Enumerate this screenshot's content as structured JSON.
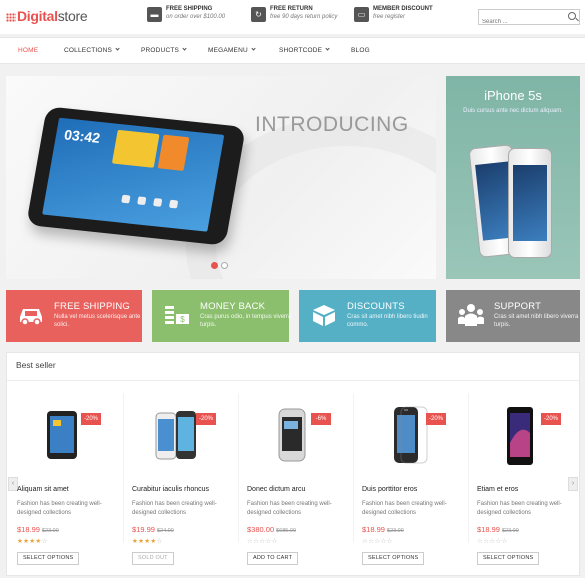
{
  "logo": {
    "part1": "Digital",
    "part2": "store"
  },
  "promos": [
    {
      "icon": "truck-icon",
      "title": "FREE SHIPPING",
      "sub": "on order over $100.00"
    },
    {
      "icon": "return-icon",
      "title": "FREE RETURN",
      "sub": "free 90 days return policy"
    },
    {
      "icon": "card-icon",
      "title": "MEMBER DISCOUNT",
      "sub": "free register"
    }
  ],
  "search": {
    "placeholder": "Search ..."
  },
  "nav": [
    {
      "label": "HOME",
      "active": true
    },
    {
      "label": "COLLECTIONS",
      "dropdown": true
    },
    {
      "label": "PRODUCTS",
      "dropdown": true
    },
    {
      "label": "MEGAMENU",
      "dropdown": true
    },
    {
      "label": "SHORTCODE",
      "dropdown": true
    },
    {
      "label": "BLOG"
    }
  ],
  "hero": {
    "title": "INTRODUCING",
    "tablet_time": "03:42",
    "slides": 2,
    "active_slide": 1
  },
  "side_banner": {
    "title": "iPhone 5s",
    "sub": "Duis cursus ante nec dictum aliquam."
  },
  "features": [
    {
      "title": "FREE SHIPPING",
      "sub": "Nulla vel metus scelerisque ante solici.",
      "color": "#e8615d",
      "icon": "car-icon"
    },
    {
      "title": "MONEY BACK",
      "sub": "Cras purus odio, in tempus viverra turpis.",
      "color": "#8bbf6e",
      "icon": "money-icon"
    },
    {
      "title": "DISCOUNTS",
      "sub": "Cras sit amet nibh libero tiudin commo.",
      "color": "#55b0c6",
      "icon": "box-icon"
    },
    {
      "title": "SUPPORT",
      "sub": "Cras sit amet nibh libero viverra turpis.",
      "color": "#888888",
      "icon": "people-icon"
    }
  ],
  "best_seller": {
    "title": "Best seller",
    "products": [
      {
        "name": "Aliquam sit amet",
        "desc": "Fashion has been creating well-designed collections",
        "price": "$18.99",
        "old": "$23.00",
        "sale": "-20%",
        "stars": 4,
        "button": "SELECT OPTIONS",
        "disabled": false
      },
      {
        "name": "Curabitur iaculis rhoncus",
        "desc": "Fashion has been creating well-designed collections",
        "price": "$19.99",
        "old": "$24.00",
        "sale": "-20%",
        "stars": 4,
        "button": "SOLD OUT",
        "disabled": true
      },
      {
        "name": "Donec dictum arcu",
        "desc": "Fashion has been creating well-designed collections",
        "price": "$380.00",
        "old": "$685.00",
        "sale": "-6%",
        "stars": 0,
        "button": "ADD TO CART",
        "disabled": false
      },
      {
        "name": "Duis porttitor eros",
        "desc": "Fashion has been creating well-designed collections",
        "price": "$18.99",
        "old": "$23.00",
        "sale": "-20%",
        "stars": 0,
        "button": "SELECT OPTIONS",
        "disabled": false
      },
      {
        "name": "Etiam et eros",
        "desc": "Fashion has been creating well-designed collections",
        "price": "$18.99",
        "old": "$23.00",
        "sale": "-20%",
        "stars": 0,
        "button": "SELECT OPTIONS",
        "disabled": false
      }
    ]
  }
}
